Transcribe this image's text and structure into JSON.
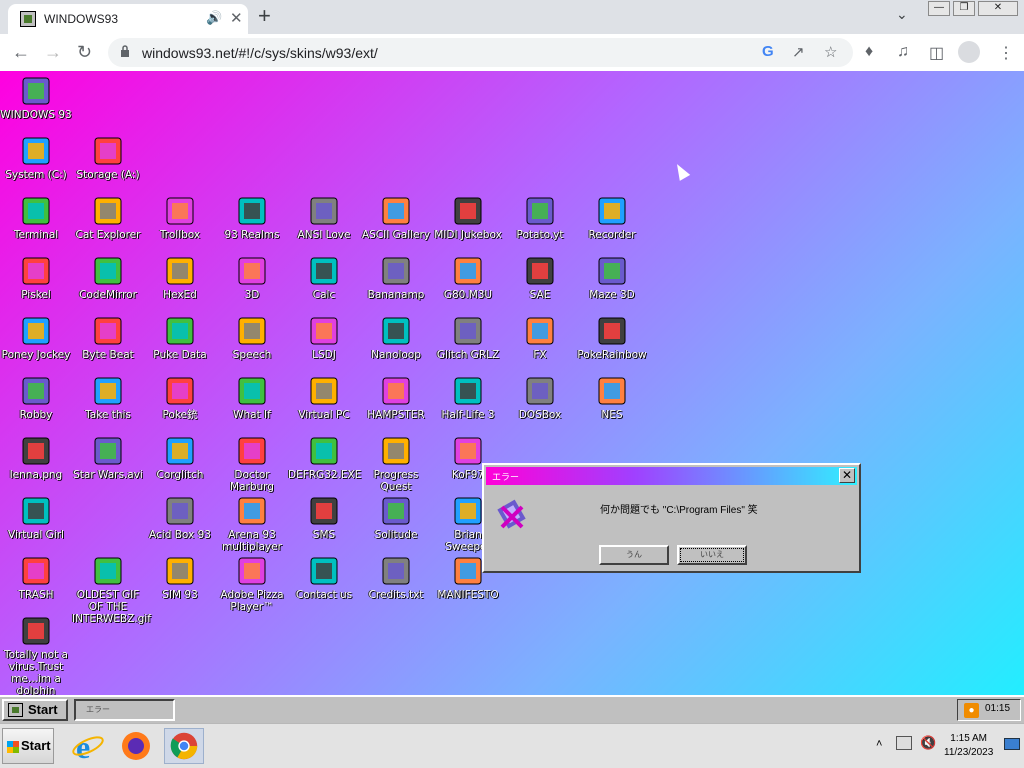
{
  "browser": {
    "tab_title": "WINDOWS93",
    "url": "windows93.net/#!/c/sys/skins/w93/ext/"
  },
  "desktop": {
    "icons": [
      {
        "label": "WINDOWS 93"
      },
      {
        "label": "System (C:)"
      },
      {
        "label": "Storage (A:)"
      },
      {
        "label": "Terminal"
      },
      {
        "label": "Cat Explorer"
      },
      {
        "label": "Trollbox"
      },
      {
        "label": "93 Realms"
      },
      {
        "label": "ANSI Love"
      },
      {
        "label": "ASCII Gallery"
      },
      {
        "label": "MIDI Jukebox"
      },
      {
        "label": "Potato.yt"
      },
      {
        "label": "Recorder"
      },
      {
        "label": "Piskel"
      },
      {
        "label": "CodeMirror"
      },
      {
        "label": "HexEd"
      },
      {
        "label": "3D"
      },
      {
        "label": "Calc"
      },
      {
        "label": "Bananamp"
      },
      {
        "label": "G80.M3U"
      },
      {
        "label": "SAE"
      },
      {
        "label": "Maze 3D"
      },
      {
        "label": "Poney Jockey"
      },
      {
        "label": "Byte Beat"
      },
      {
        "label": "Puke Data"
      },
      {
        "label": "Speech"
      },
      {
        "label": "LSDJ"
      },
      {
        "label": "Nanoloop"
      },
      {
        "label": "Glitch GRLZ"
      },
      {
        "label": "FX"
      },
      {
        "label": "PokeRainbow"
      },
      {
        "label": "Robby"
      },
      {
        "label": "Take this"
      },
      {
        "label": "Poke銃"
      },
      {
        "label": "What If"
      },
      {
        "label": "Virtual PC"
      },
      {
        "label": "HAMPSTER"
      },
      {
        "label": "Half-Life 3"
      },
      {
        "label": "DOSBox"
      },
      {
        "label": "NES"
      },
      {
        "label": "lenna.png"
      },
      {
        "label": "Star Wars.avi"
      },
      {
        "label": "Corglitch"
      },
      {
        "label": "Doctor Marburg"
      },
      {
        "label": "DEFRG32.EXE"
      },
      {
        "label": "Progress Quest"
      },
      {
        "label": "KoF97"
      },
      {
        "label": "Virtual Girl"
      },
      {
        "label": "Acid Box 93"
      },
      {
        "label": "Arena 93 multiplayer"
      },
      {
        "label": "SMS"
      },
      {
        "label": "Solitude"
      },
      {
        "label": "Brian Sweeper"
      },
      {
        "label": "TRASH"
      },
      {
        "label": "OLDEST GIF OF THE INTERWEBZ.gif"
      },
      {
        "label": "SIM 93"
      },
      {
        "label": "Adobe Pizza Player™"
      },
      {
        "label": "Contact us"
      },
      {
        "label": "Credits.txt"
      },
      {
        "label": "MANIFESTO"
      },
      {
        "label": "Totally not a virus.Trust me...im a dolphin"
      }
    ]
  },
  "dialog": {
    "title": "エラー",
    "message": "何か問題でも \"C:\\Program Files\" 笑",
    "yes": "うん",
    "no": "いいえ"
  },
  "w93_taskbar": {
    "start": "Start",
    "window": "エラー",
    "clock": "01:15"
  },
  "host_taskbar": {
    "start": "Start",
    "time": "1:15 AM",
    "date": "11/23/2023"
  },
  "colors": {
    "desktop_gradient": [
      "#ff00e0",
      "#b266ff",
      "#7bb2ff",
      "#22eeff"
    ],
    "dialog_titlebar": [
      "#ff00d8",
      "#30f0ff"
    ],
    "w93_chrome": "#c0c0c0"
  }
}
